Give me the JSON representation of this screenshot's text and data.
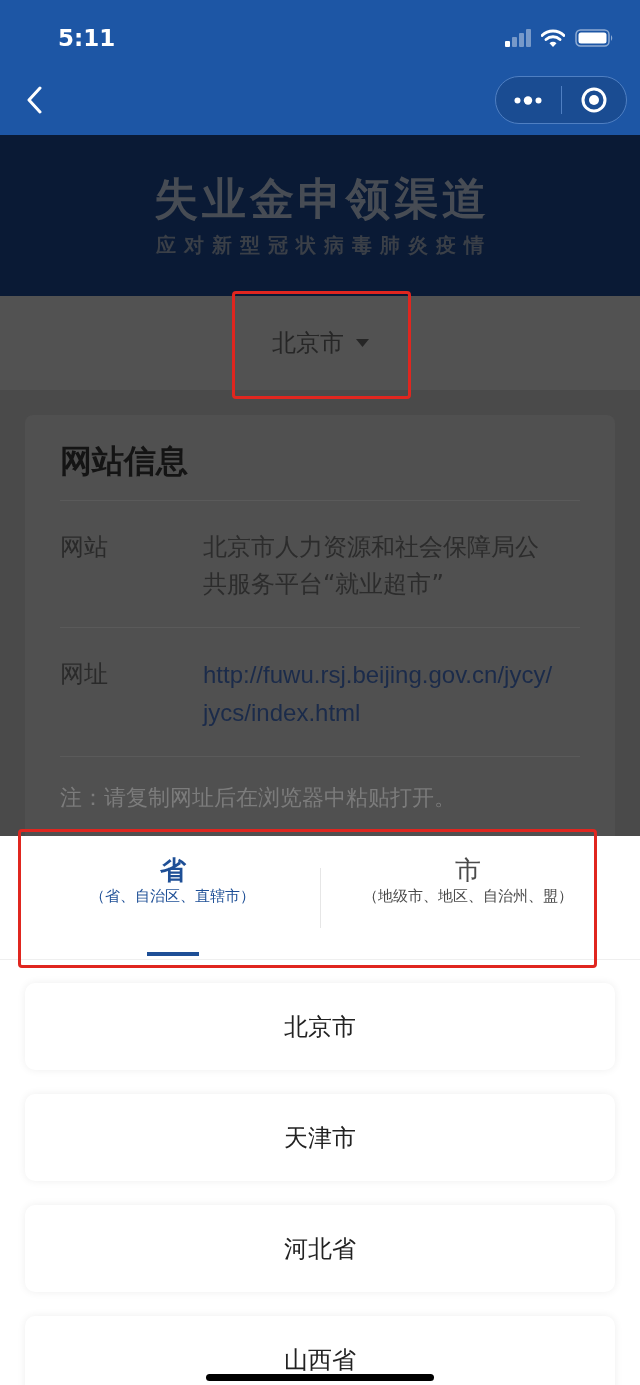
{
  "status_bar": {
    "time": "5:11"
  },
  "banner": {
    "title": "失业金申领渠道",
    "subtitle": "应对新型冠状病毒肺炎疫情"
  },
  "region_selector": {
    "value": "北京市"
  },
  "info_card": {
    "title": "网站信息",
    "rows": [
      {
        "kind": "text",
        "label": "网站",
        "value": "北京市人力资源和社会保障局公共服务平台“就业超市”"
      },
      {
        "kind": "link",
        "label": "网址",
        "value": "http://fuwu.rsj.beijing.gov.cn/jycy/jycs/index.html"
      }
    ],
    "note": "注：请复制网址后在浏览器中粘贴打开。"
  },
  "picker": {
    "tabs": [
      {
        "label": "省",
        "sublabel": "（省、自治区、直辖市）",
        "selected": true
      },
      {
        "label": "市",
        "sublabel": "（地级市、地区、自治州、盟）",
        "selected": false
      }
    ],
    "items": [
      "北京市",
      "天津市",
      "河北省",
      "山西省"
    ]
  }
}
